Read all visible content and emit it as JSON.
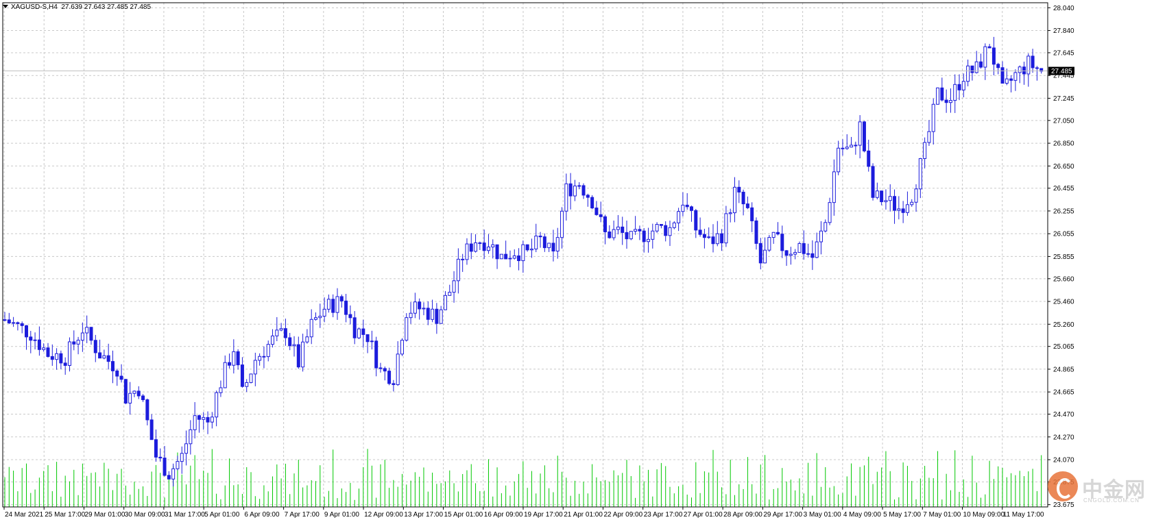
{
  "header": {
    "symbol_timeframe": "XAGUSD-S,H4",
    "ohlc": "27.639 27.643 27.485 27.485"
  },
  "current_price_label": "27.485",
  "colors": {
    "bull_candle": "#1c1cdc",
    "bear_candle": "#1c1cdc",
    "volume": "#00c800",
    "grid": "#c8c8c8",
    "price_line": "#c0c0c0",
    "price_tag_bg": "#000000",
    "price_tag_text": "#ffffff"
  },
  "watermark": {
    "name": "中金网",
    "site": "CNGOLD.COM.CN"
  },
  "chart_data": {
    "type": "candlestick",
    "instrument": "XAGUSD-S",
    "timeframe": "H4",
    "ylim": [
      23.655,
      28.06
    ],
    "grid": true,
    "y_ticks": [
      "28.040",
      "27.840",
      "27.645",
      "27.445",
      "27.245",
      "27.050",
      "26.850",
      "26.650",
      "26.455",
      "26.255",
      "26.055",
      "25.855",
      "25.660",
      "25.460",
      "25.260",
      "25.065",
      "24.865",
      "24.665",
      "24.470",
      "24.270",
      "24.070",
      "23.875",
      "23.675"
    ],
    "x_ticks": [
      "24 Mar 2021",
      "25 Mar 17:00",
      "29 Mar 01:00",
      "30 Mar 09:00",
      "31 Mar 17:00",
      "5 Apr 01:00",
      "6 Apr 09:00",
      "7 Apr 17:00",
      "9 Apr 01:00",
      "12 Apr 09:00",
      "13 Apr 17:00",
      "15 Apr 01:00",
      "16 Apr 09:00",
      "19 Apr 17:00",
      "21 Apr 01:00",
      "22 Apr 09:00",
      "23 Apr 17:00",
      "27 Apr 01:00",
      "28 Apr 09:00",
      "29 Apr 17:00",
      "3 May 01:00",
      "4 May 09:00",
      "5 May 17:00",
      "7 May 01:00",
      "10 May 09:00",
      "11 May 17:00"
    ],
    "last_price": 27.485,
    "close_anchors": [
      [
        0,
        25.3
      ],
      [
        6,
        25.18
      ],
      [
        10,
        25.0
      ],
      [
        14,
        24.97
      ],
      [
        18,
        25.22
      ],
      [
        22,
        25.0
      ],
      [
        26,
        24.88
      ],
      [
        28,
        24.62
      ],
      [
        31,
        24.7
      ],
      [
        35,
        24.1
      ],
      [
        38,
        23.95
      ],
      [
        41,
        24.1
      ],
      [
        44,
        24.45
      ],
      [
        47,
        24.4
      ],
      [
        50,
        24.75
      ],
      [
        53,
        25.05
      ],
      [
        55,
        24.65
      ],
      [
        58,
        24.95
      ],
      [
        62,
        25.12
      ],
      [
        65,
        25.2
      ],
      [
        68,
        24.92
      ],
      [
        71,
        25.25
      ],
      [
        74,
        25.4
      ],
      [
        78,
        25.47
      ],
      [
        81,
        25.22
      ],
      [
        84,
        25.16
      ],
      [
        87,
        24.85
      ],
      [
        90,
        24.8
      ],
      [
        93,
        25.38
      ],
      [
        96,
        25.4
      ],
      [
        100,
        25.33
      ],
      [
        103,
        25.55
      ],
      [
        106,
        25.86
      ],
      [
        109,
        26.0
      ],
      [
        112,
        25.98
      ],
      [
        115,
        25.85
      ],
      [
        118,
        25.9
      ],
      [
        121,
        25.88
      ],
      [
        124,
        26.0
      ],
      [
        127,
        25.85
      ],
      [
        130,
        26.44
      ],
      [
        133,
        26.5
      ],
      [
        136,
        26.35
      ],
      [
        139,
        26.05
      ],
      [
        142,
        26.08
      ],
      [
        145,
        26.0
      ],
      [
        148,
        26.05
      ],
      [
        151,
        26.1
      ],
      [
        154,
        26.1
      ],
      [
        157,
        26.35
      ],
      [
        160,
        26.1
      ],
      [
        163,
        25.98
      ],
      [
        166,
        26.05
      ],
      [
        169,
        26.42
      ],
      [
        172,
        26.25
      ],
      [
        175,
        25.8
      ],
      [
        178,
        26.02
      ],
      [
        181,
        25.9
      ],
      [
        184,
        25.95
      ],
      [
        187,
        25.85
      ],
      [
        190,
        26.15
      ],
      [
        193,
        26.82
      ],
      [
        196,
        26.78
      ],
      [
        198,
        27.0
      ],
      [
        201,
        26.38
      ],
      [
        204,
        26.35
      ],
      [
        207,
        26.28
      ],
      [
        210,
        26.4
      ],
      [
        213,
        26.78
      ],
      [
        216,
        27.28
      ],
      [
        219,
        27.25
      ],
      [
        222,
        27.45
      ],
      [
        225,
        27.5
      ],
      [
        228,
        27.72
      ],
      [
        231,
        27.3
      ],
      [
        234,
        27.45
      ],
      [
        237,
        27.55
      ],
      [
        240,
        27.485
      ]
    ],
    "candle_count": 241
  }
}
